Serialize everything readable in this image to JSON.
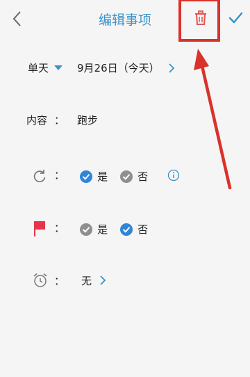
{
  "header": {
    "title": "编辑事项",
    "back_icon": "chevron-left-icon",
    "delete_icon": "trash-icon",
    "confirm_icon": "check-icon"
  },
  "date_row": {
    "mode_label": "单天",
    "date_value": "9月26日（今天）"
  },
  "content_row": {
    "label": "内容",
    "colon": "：",
    "value": "跑步"
  },
  "repeat_row": {
    "icon": "refresh-icon",
    "colon": "：",
    "yes_label": "是",
    "no_label": "否",
    "selected": "是",
    "info_icon": "info-icon"
  },
  "flag_row": {
    "icon": "flag-icon",
    "colon": "：",
    "yes_label": "是",
    "no_label": "否",
    "selected": "否"
  },
  "alarm_row": {
    "icon": "alarm-clock-icon",
    "colon": "：",
    "value": "无"
  },
  "colors": {
    "accent": "#3a93c9",
    "check_blue": "#2f86d6",
    "unchecked_grey": "#8f8f8f",
    "delete_red": "#e25555",
    "flag_red": "#e8344a",
    "annotation_red": "#d9322b"
  }
}
